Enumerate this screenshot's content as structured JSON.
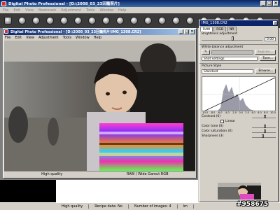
{
  "app": {
    "title": "Digital Photo Professional - [D:\\2008_03_23回籠照片]"
  },
  "menu": [
    "File",
    "Edit",
    "View",
    "Bookmark",
    "Adjustment",
    "Tools",
    "Window",
    "Help"
  ],
  "child": {
    "title": "Digital Photo Professional - [D:\\2008_03_23回籠照片\\IMG_1308.CR2]",
    "menu": [
      "File",
      "Edit",
      "View",
      "Adjustment",
      "Tools",
      "Window",
      "Help"
    ],
    "status": [
      "High quality",
      "RAW / Wide Gamut RGB"
    ]
  },
  "status": {
    "quality": "High quality",
    "recipe": "Recipe data: No",
    "images": "Number of images: 4",
    "extra": "Im"
  },
  "palette": {
    "title": "IMG_1308.CR2",
    "tabs": [
      "RAW",
      "RGB",
      "NR"
    ],
    "brightness_label": "Brightness adjustment",
    "brightness_value": "0.00",
    "wb_label": "White balance adjustment",
    "wb_register": "Register...",
    "wb_select": "Shot settings",
    "wb_tune": "Tune...",
    "ps_label": "Picture Style",
    "ps_select": "Standard",
    "ps_browse": "Browse...",
    "axis": [
      "-10.0",
      "-8.0",
      "-6.0",
      "-4.0",
      "-2.0",
      "0.0",
      "2.0",
      "4.0",
      "6.0",
      "8.0",
      "10.0"
    ],
    "contrast": "Contrast (0)",
    "linear": "Linear",
    "color_tone": "Color tone (0)",
    "color_sat": "Color saturation (0)",
    "sharpness": "Sharpness (3)"
  },
  "watermark": "#958675"
}
